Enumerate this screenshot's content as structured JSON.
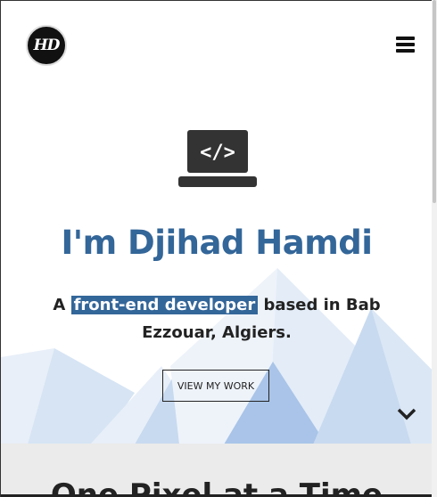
{
  "header": {
    "logo_text": "HD",
    "menu_icon": "hamburger-icon"
  },
  "hero": {
    "icon": "laptop-code-icon",
    "heading": "I'm Djihad Hamdi",
    "tagline_prefix": "A",
    "tagline_highlight": "front-end developer",
    "tagline_suffix": "based in Bab Ezzouar, Algiers.",
    "cta_label": "VIEW MY WORK",
    "scroll_icon": "chevron-down-icon",
    "colors": {
      "accent": "#336699",
      "mountain_light": "#e8eff8",
      "mountain_mid": "#c8daf0",
      "mountain_dark": "#a9c4e8"
    }
  },
  "next_section": {
    "heading": "One Pixel at a Time"
  }
}
